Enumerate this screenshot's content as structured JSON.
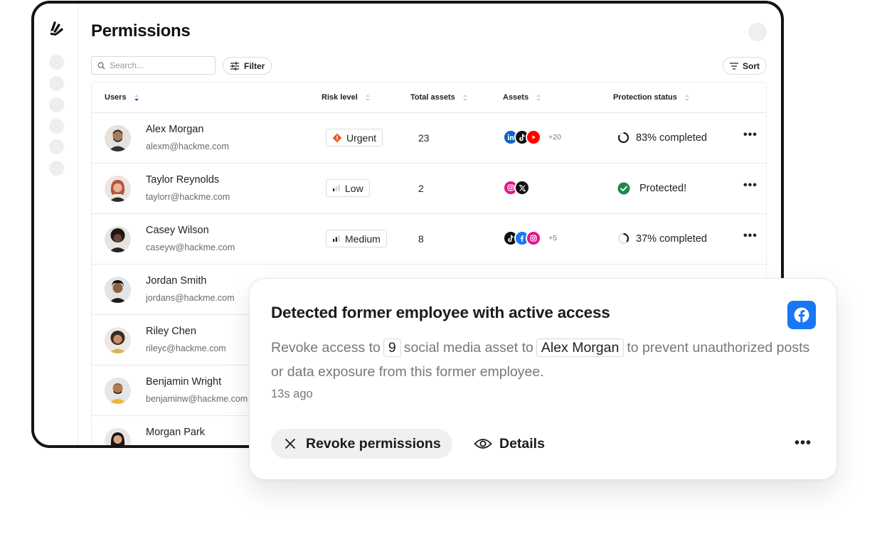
{
  "page": {
    "title": "Permissions"
  },
  "toolbar": {
    "search_placeholder": "Search...",
    "filter_label": "Filter",
    "sort_label": "Sort"
  },
  "table": {
    "columns": [
      "Users",
      "Risk level",
      "Total assets",
      "Assets",
      "Protection status"
    ],
    "rows": [
      {
        "name": "Alex Morgan",
        "email": "alexm@hackme.com",
        "risk": "Urgent",
        "risk_icon": "urgent-diamond-icon",
        "total": "23",
        "assets": [
          "linkedin-icon",
          "tiktok-icon",
          "youtube-icon"
        ],
        "assets_more": "+20",
        "status": "83% completed",
        "status_icon": "progress-ring-icon",
        "progress": 0.83
      },
      {
        "name": "Taylor Reynolds",
        "email": "taylorr@hackme.com",
        "risk": "Low",
        "risk_icon": "signal-low-icon",
        "total": "2",
        "assets": [
          "instagram-icon",
          "x-icon"
        ],
        "assets_more": "",
        "status": "Protected!",
        "status_icon": "check-circle-icon",
        "progress": 1
      },
      {
        "name": "Casey Wilson",
        "email": "caseyw@hackme.com",
        "risk": "Medium",
        "risk_icon": "signal-medium-icon",
        "total": "8",
        "assets": [
          "tiktok-icon",
          "facebook-icon",
          "instagram-icon"
        ],
        "assets_more": "+5",
        "status": "37% completed",
        "status_icon": "progress-ring-icon",
        "progress": 0.37
      },
      {
        "name": "Jordan Smith",
        "email": "jordans@hackme.com"
      },
      {
        "name": "Riley Chen",
        "email": "rileyc@hackme.com"
      },
      {
        "name": "Benjamin Wright",
        "email": "benjaminw@hackme.com"
      },
      {
        "name": "Morgan Park",
        "email": ""
      }
    ]
  },
  "notification": {
    "title": "Detected former employee with active access",
    "body_pre": "Revoke access to",
    "count": "9",
    "body_mid": "social media asset to",
    "target_user": "Alex Morgan",
    "body_post": "to prevent unauthorized posts or data exposure from this former employee.",
    "time": "13s ago",
    "revoke_label": "Revoke permissions",
    "details_label": "Details",
    "platform_icon": "facebook-icon"
  },
  "colors": {
    "urgent": "#e8582a",
    "protected": "#1e8a45",
    "facebook": "#1877f2",
    "linkedin": "#0a66c2",
    "youtube": "#ff0000",
    "instagram": "#e1148a"
  }
}
